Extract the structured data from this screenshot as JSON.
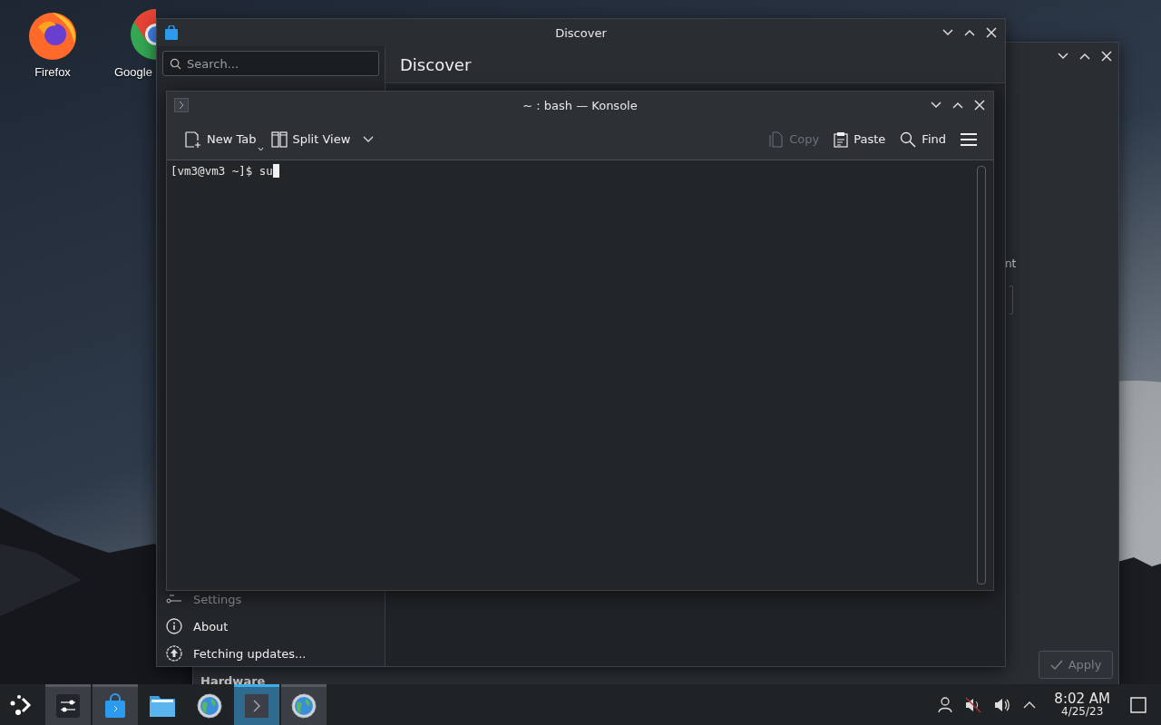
{
  "desktop_icons": [
    {
      "label": "Firefox",
      "kind": "firefox"
    },
    {
      "label": "Google",
      "kind": "chrome"
    }
  ],
  "settings_window": {
    "partial_text": "nt",
    "sidebar_heading": "Hardware",
    "apply_button": {
      "label": "Apply",
      "disabled": true
    }
  },
  "discover_window": {
    "title": "Discover",
    "search": {
      "placeholder": "Search..."
    },
    "heading": "Discover",
    "sidebar_items": [
      {
        "label": "Settings",
        "kind": "settings",
        "disabled": true
      },
      {
        "label": "About",
        "kind": "about",
        "disabled": false
      },
      {
        "label": "Fetching updates...",
        "kind": "update",
        "disabled": false
      }
    ]
  },
  "konsole_window": {
    "title": "~ : bash — Konsole",
    "toolbar": [
      {
        "label": "New Tab",
        "kind": "new-tab",
        "disabled": false
      },
      {
        "label": "Split View",
        "kind": "split-view",
        "disabled": false
      },
      {
        "label": "Copy",
        "kind": "copy",
        "disabled": true
      },
      {
        "label": "Paste",
        "kind": "paste",
        "disabled": false
      },
      {
        "label": "Find",
        "kind": "find",
        "disabled": false
      },
      {
        "kind": "menu",
        "disabled": false
      }
    ],
    "terminal_lines": [
      "[vm3@vm3 ~]$ su"
    ]
  },
  "taskbar": {
    "tasks": [
      {
        "kind": "settings",
        "open": true,
        "selected": false
      },
      {
        "kind": "discover",
        "open": true,
        "selected": false
      },
      {
        "kind": "files",
        "open": false,
        "selected": false
      },
      {
        "kind": "globe",
        "open": false,
        "selected": false
      },
      {
        "kind": "terminal",
        "open": true,
        "selected": true
      },
      {
        "kind": "globe",
        "open": true,
        "selected": false
      }
    ],
    "tray": [
      {
        "kind": "user"
      },
      {
        "kind": "muted"
      },
      {
        "kind": "volume"
      },
      {
        "kind": "expand"
      }
    ],
    "time": "8:02 AM",
    "date": "4/25/23"
  }
}
